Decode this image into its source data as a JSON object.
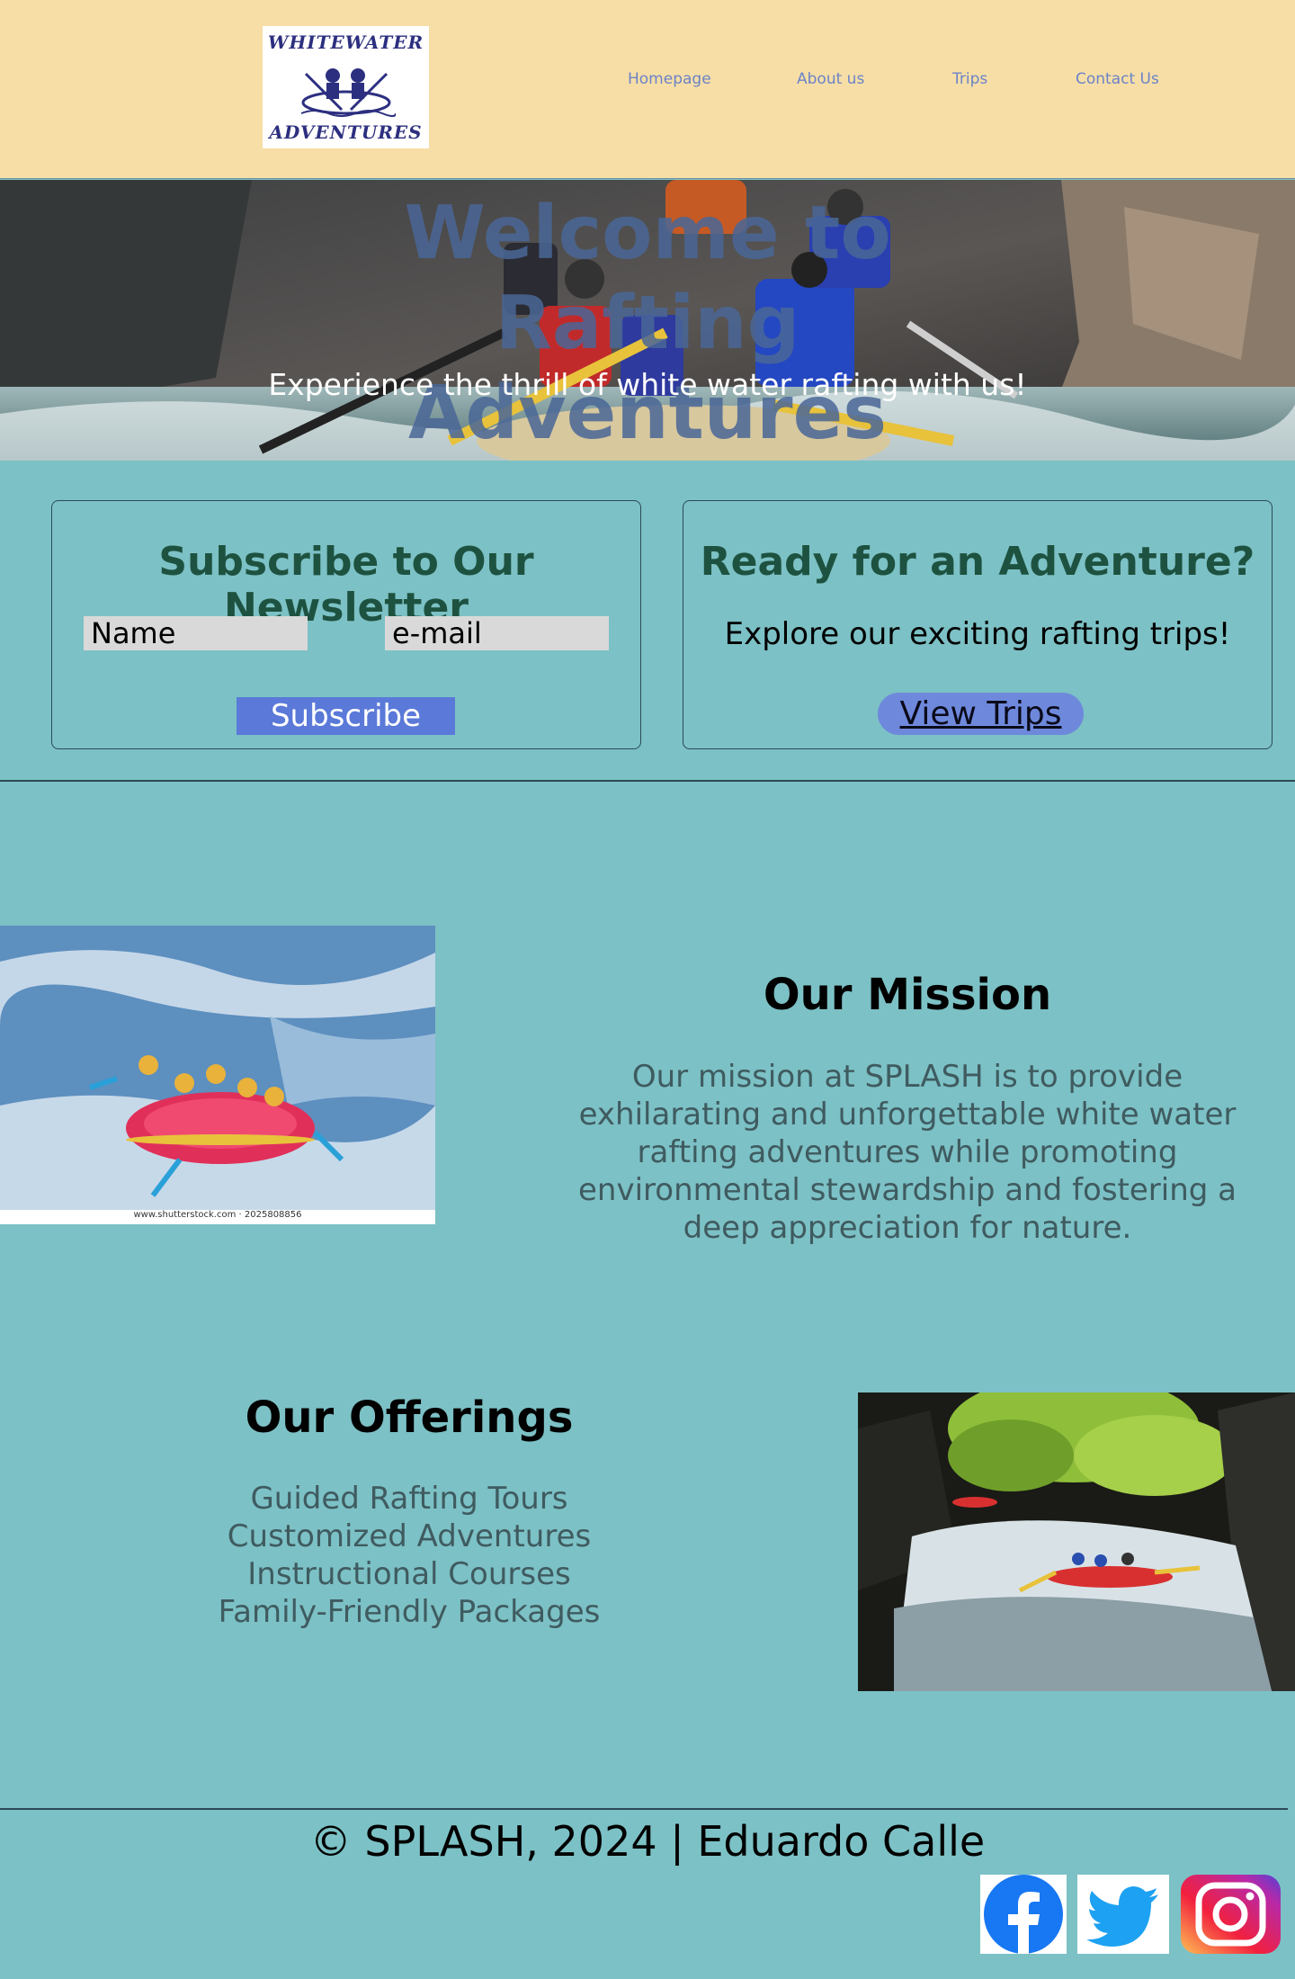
{
  "header": {
    "logo_alt": "Whitewater Adventures logo",
    "logo_text_top": "WHITEWATER",
    "logo_text_bottom": "ADVENTURES",
    "nav": [
      {
        "label": "Homepage"
      },
      {
        "label": "About us"
      },
      {
        "label": "Trips"
      },
      {
        "label": "Contact Us"
      }
    ]
  },
  "hero": {
    "title": "Welcome to Rafting Adventures",
    "subtitle": "Experience the thrill of white water rafting with us!"
  },
  "newsletter": {
    "title": "Subscribe to Our Newsletter",
    "name_placeholder": "Name",
    "email_placeholder": "e-mail",
    "button_label": "Subscribe"
  },
  "adventure": {
    "title": "Ready for an Adventure?",
    "text": "Explore our exciting rafting trips!",
    "button_label": "View Trips"
  },
  "mission": {
    "title": "Our Mission",
    "body": "Our mission at SPLASH is to provide exhilarating and unforgettable white water rafting adventures while promoting environmental stewardship and fostering a deep appreciation for nature.",
    "image_watermark": "www.shutterstock.com · 2025808856"
  },
  "offerings": {
    "title": "Our Offerings",
    "items": [
      "Guided Rafting Tours",
      "Customized Adventures",
      "Instructional Courses",
      "Family-Friendly Packages"
    ]
  },
  "footer": {
    "copyright": "© SPLASH, 2024 | Eduardo Calle",
    "social_icons": [
      "facebook-icon",
      "twitter-icon",
      "instagram-icon"
    ]
  },
  "colors": {
    "header_bg": "#f6dea6",
    "page_bg": "#7cc1c5",
    "nav_text": "#6c83c8",
    "subscribe_button": "#5a79d8",
    "view_trips_button": "#6e89dc",
    "card_title": "#1e5240"
  }
}
